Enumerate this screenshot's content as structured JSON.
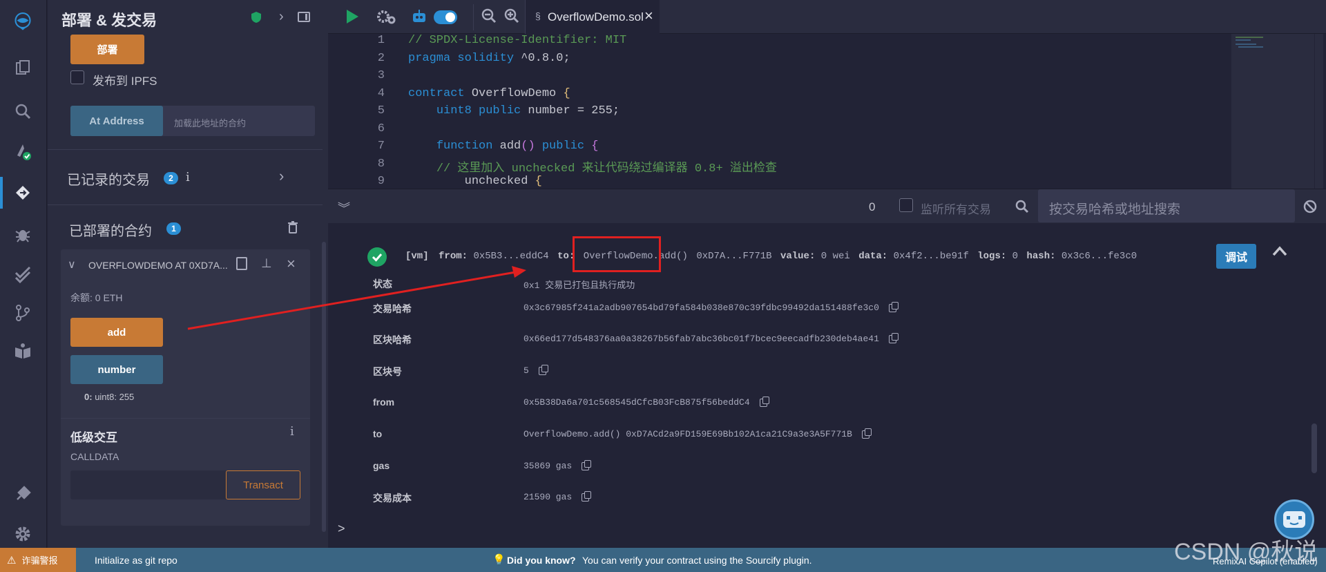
{
  "panel": {
    "title": "部署 & 发交易",
    "deploy_button": "部署",
    "publish_ipfs_label": "发布到 IPFS",
    "at_address_button": "At Address",
    "at_address_placeholder": "加载此地址的合约",
    "recorded_tx_label": "已记录的交易",
    "recorded_tx_count": "2",
    "deployed_label": "已部署的合约",
    "deployed_count": "1",
    "contract_instance_title": "OVERFLOWDEMO AT 0XD7A...",
    "balance_label": "余额: 0 ETH",
    "add_button": "add",
    "number_button": "number",
    "number_result_key": "0:",
    "number_result_value": "uint8: 255",
    "low_level_title": "低级交互",
    "calldata_label": "CALLDATA",
    "transact_button": "Transact"
  },
  "editor": {
    "tab_filename": "OverflowDemo.sol",
    "line_numbers": [
      "1",
      "2",
      "3",
      "4",
      "5",
      "6",
      "7",
      "8",
      "9"
    ]
  },
  "terminal": {
    "pending_count": "0",
    "listen_all_label": "监听所有交易",
    "search_placeholder": "按交易哈希或地址搜索",
    "summary": {
      "vm": "[vm]",
      "from_key": "from:",
      "from_val": "0x5B3...eddC4",
      "to_key": "to:",
      "to_val": "OverflowDemo.add()",
      "to_addr": "0xD7A...F771B",
      "value_key": "value:",
      "value_val": "0 wei",
      "data_key": "data:",
      "data_val": "0x4f2...be91f",
      "logs_key": "logs:",
      "logs_val": "0",
      "hash_key": "hash:",
      "hash_val": "0x3c6...fe3c0"
    },
    "debug_button": "调试",
    "rows": [
      {
        "label": "状态",
        "value": "0x1 交易已打包且执行成功"
      },
      {
        "label": "交易哈希",
        "value": "0x3c67985f241a2adb907654bd79fa584b038e870c39fdbc99492da151488fe3c0"
      },
      {
        "label": "区块哈希",
        "value": "0x66ed177d548376aa0a38267b56fab7abc36bc01f7bcec9eecadfb230deb4ae41"
      },
      {
        "label": "区块号",
        "value": "5"
      },
      {
        "label": "from",
        "value": "0x5B38Da6a701c568545dCfcB03FcB875f56beddC4"
      },
      {
        "label": "to",
        "value": "OverflowDemo.add() 0xD7ACd2a9FD159E69Bb102A1ca21C9a3e3A5F771B"
      },
      {
        "label": "gas",
        "value": "35869 gas"
      },
      {
        "label": "交易成本",
        "value": "21590 gas"
      }
    ],
    "prompt": ">"
  },
  "statusbar": {
    "scam_alert": "诈骗警报",
    "git_init": "Initialize as git repo",
    "did_you_know": "Did you know?",
    "tip": "You can verify your contract using the Sourcify plugin.",
    "copilot": "RemixAI Copilot (enabled)"
  },
  "watermark": "CSDN @秋说",
  "colors": {
    "accent": "#2b8fd5",
    "orange": "#c87a35",
    "success": "#1fa463",
    "highlight": "#e02020"
  }
}
